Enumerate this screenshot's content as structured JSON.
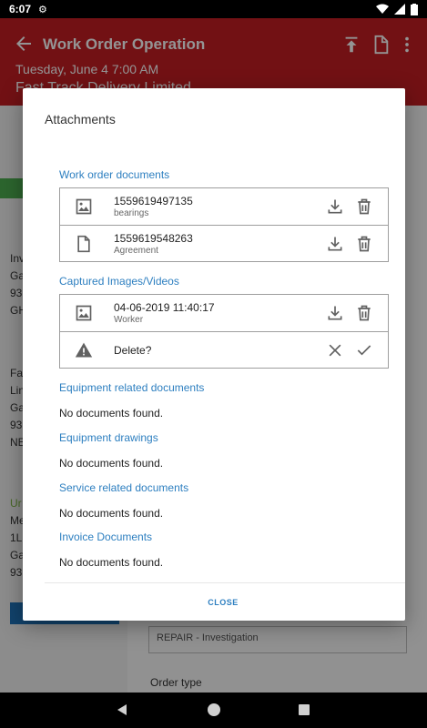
{
  "status_bar": {
    "time": "6:07"
  },
  "app_bar": {
    "title": "Work Order Operation",
    "date": "Tuesday, June 4 7:00 AM",
    "subtitle": "Fast Track Delivery Limited"
  },
  "background": {
    "left_lines": [
      "Inv",
      "Ga",
      "93",
      "GH",
      "Fa",
      "Lin",
      "Ga",
      "93",
      "NE",
      "Ur",
      "Me",
      "1L",
      "Ga",
      "93"
    ],
    "repair_field": "REPAIR - Investigation",
    "order_type_label": "Order type"
  },
  "dialog": {
    "title": "Attachments",
    "sections": {
      "work_order_documents": {
        "title": "Work order documents",
        "items": [
          {
            "name": "1559619497135",
            "description": "bearings",
            "type_icon": "image-icon"
          },
          {
            "name": "1559619548263",
            "description": "Agreement",
            "type_icon": "document-icon"
          }
        ]
      },
      "captured_media": {
        "title": "Captured Images/Videos",
        "item": {
          "name": "04-06-2019 11:40:17",
          "description": "Worker",
          "type_icon": "image-icon"
        },
        "delete_prompt": "Delete?"
      },
      "equipment_documents": {
        "title": "Equipment related documents",
        "empty": "No documents found."
      },
      "equipment_drawings": {
        "title": "Equipment drawings",
        "empty": "No documents found."
      },
      "service_documents": {
        "title": "Service related documents",
        "empty": "No documents found."
      },
      "invoice_documents": {
        "title": "Invoice Documents",
        "empty": "No documents found."
      }
    },
    "close_label": "CLOSE"
  },
  "colors": {
    "app_bar": "#c41e24",
    "accent_blue": "#2d7fc0",
    "icon_gray": "#616161"
  }
}
